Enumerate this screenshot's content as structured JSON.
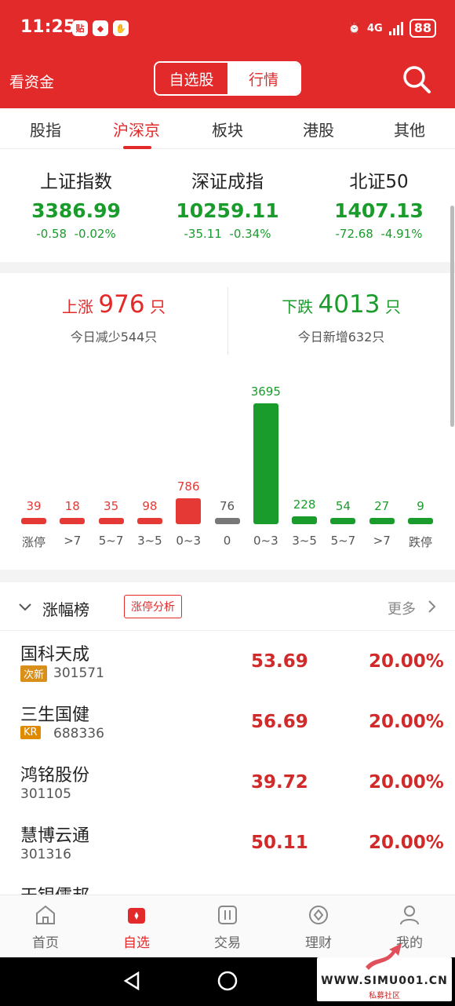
{
  "status_bar": {
    "time": "11:25",
    "notif_icons": [
      "贴",
      "◆",
      "✋"
    ],
    "network": "4G",
    "battery": "88"
  },
  "header": {
    "left_link": "看资金",
    "segment": [
      "自选股",
      "行情"
    ],
    "active_segment": "自选股",
    "search_icon": "search-icon"
  },
  "tabs": {
    "items": [
      "股指",
      "沪深京",
      "板块",
      "港股",
      "其他"
    ],
    "active": "沪深京"
  },
  "indices": [
    {
      "name": "上证指数",
      "value": "3386.99",
      "change": "-0.58",
      "pct": "-0.02%"
    },
    {
      "name": "深证成指",
      "value": "10259.11",
      "change": "-35.11",
      "pct": "-0.34%"
    },
    {
      "name": "北证50",
      "value": "1407.13",
      "change": "-72.68",
      "pct": "-4.91%"
    }
  ],
  "breadth": {
    "up_label": "上涨",
    "up_count": "976",
    "up_unit": "只",
    "up_sub": "今日减少544只",
    "down_label": "下跌",
    "down_count": "4013",
    "down_unit": "只",
    "down_sub": "今日新增632只"
  },
  "chart_data": {
    "type": "bar",
    "categories": [
      "涨停",
      ">7",
      "5~7",
      "3~5",
      "0~3",
      "0",
      "0~3",
      "3~5",
      "5~7",
      ">7",
      "跌停"
    ],
    "values": [
      39,
      18,
      35,
      98,
      786,
      76,
      3695,
      228,
      54,
      27,
      9
    ],
    "colors": [
      "#e53935",
      "#e53935",
      "#e53935",
      "#e53935",
      "#e53935",
      "#777777",
      "#1a9c2c",
      "#1a9c2c",
      "#1a9c2c",
      "#1a9c2c",
      "#1a9c2c"
    ],
    "title": "",
    "xlabel": "",
    "ylabel": ""
  },
  "ranking": {
    "title": "涨幅榜",
    "tag": "涨停分析",
    "more": "更多",
    "rows": [
      {
        "name": "国科天成",
        "tag": "次新",
        "tag_color": "#d9901a",
        "code": "301571",
        "price": "53.69",
        "pct": "20.00%"
      },
      {
        "name": "三生国健",
        "tag": "KR",
        "tag_color": "#e08a00",
        "code": "688336",
        "price": "56.69",
        "pct": "20.00%"
      },
      {
        "name": "鸿铭股份",
        "tag": "",
        "tag_color": "",
        "code": "301105",
        "price": "39.72",
        "pct": "20.00%"
      },
      {
        "name": "慧博云通",
        "tag": "",
        "tag_color": "",
        "code": "301316",
        "price": "50.11",
        "pct": "20.00%"
      },
      {
        "name": "天银儒邦",
        "tag": "",
        "tag_color": "",
        "code": "",
        "price": "",
        "pct": ""
      }
    ]
  },
  "bottom_nav": {
    "items": [
      "首页",
      "自选",
      "交易",
      "理财",
      "我的"
    ],
    "active": "自选"
  },
  "watermark": {
    "text": "WWW.SIMU001.CN",
    "sub": "私募社区"
  }
}
